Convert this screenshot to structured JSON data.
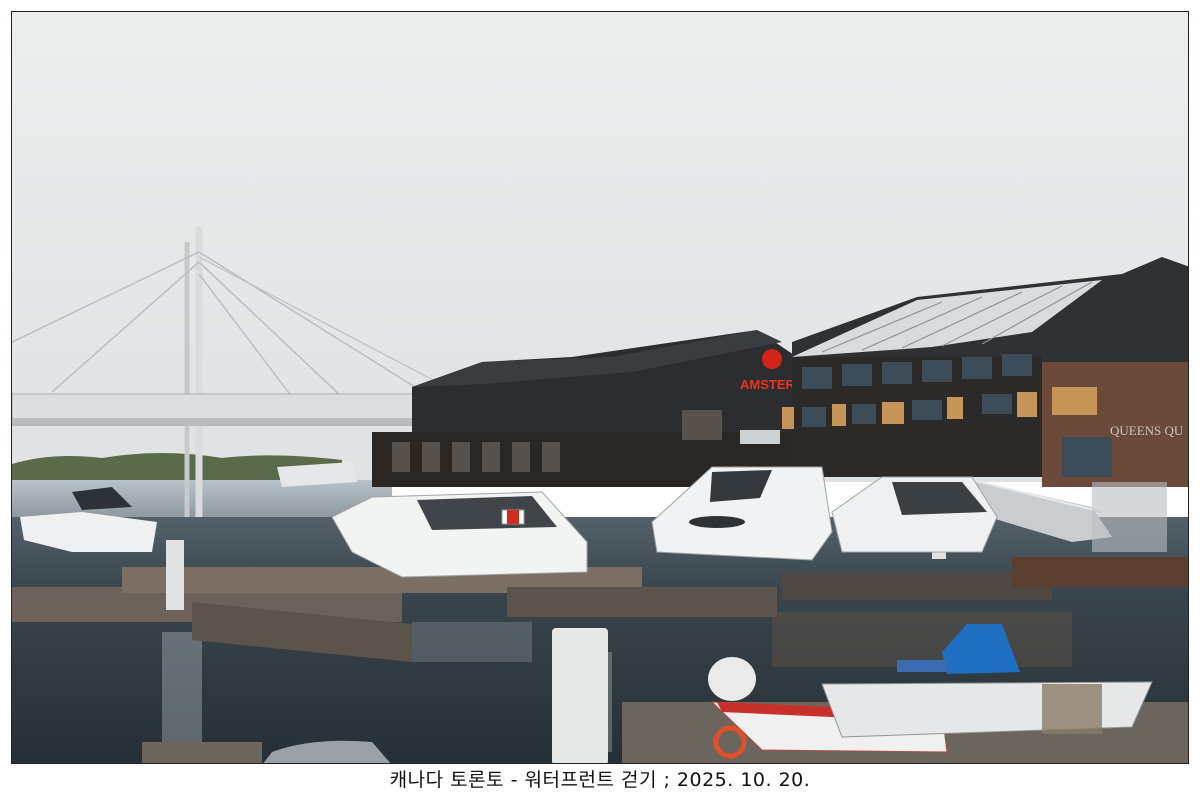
{
  "caption": "캐나다 토론토 - 워터프런트 걷기 ; 2025. 10. 20.",
  "scene": {
    "signage": {
      "restaurant_sign": "AMSTER",
      "building_sign": "QUEENS QU"
    },
    "colors": {
      "sky": "#e9eaea",
      "water": "#2f3a40",
      "roof": "#34363a",
      "brick": "#6e4a3c",
      "sign_red": "#d32419",
      "boat_cover_blue": "#1f6fc2"
    }
  }
}
